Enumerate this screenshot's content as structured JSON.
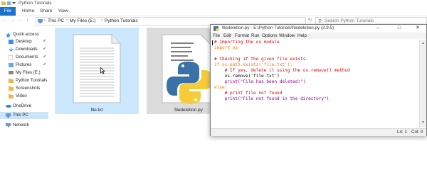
{
  "explorer": {
    "title": "Python Tutorials",
    "ribbon": {
      "file": "File",
      "home": "Home",
      "share": "Share",
      "view": "View"
    },
    "address": {
      "crumbs": [
        "This PC",
        "My Files (E:)",
        "Python Tutorials"
      ]
    },
    "search_placeholder": "Search Python Tutorials",
    "nav": {
      "quick_access": "Quick access",
      "items": [
        "Desktop",
        "Downloads",
        "Documents",
        "Pictures",
        "My Files (E:)",
        "Python Tutorials",
        "Screenshots",
        "Video"
      ],
      "onedrive": "OneDrive",
      "this_pc": "This PC",
      "network": "Network"
    },
    "files": [
      {
        "name": "file.txt"
      },
      {
        "name": "filedeletion.py"
      }
    ]
  },
  "idle": {
    "title": "filedeletion.py - E:\\Python Tutorials\\filedeletion.py (3.9.5)",
    "menus": [
      "File",
      "Edit",
      "Format",
      "Run",
      "Options",
      "Window",
      "Help"
    ],
    "code": [
      "# Importing the os module",
      "import os",
      "",
      "# Checking if the given file exists",
      "if os.path.exists('file.txt'):",
      "    # If yes, delete it using the os.remove() method",
      "    os.remove('file.txt')",
      "    print(\"File has been deleted!\")",
      "else:",
      "    # print file not found",
      "    print(\"File not found in the directory\")"
    ],
    "status": {
      "line": "Ln: 1",
      "col": "Col: 0"
    }
  },
  "colors": {
    "accent": "#1a73c8",
    "selected_tile": "#cce8ff",
    "comment": "#dd0000",
    "keyword": "#ff7700",
    "string": "#00aa00"
  }
}
